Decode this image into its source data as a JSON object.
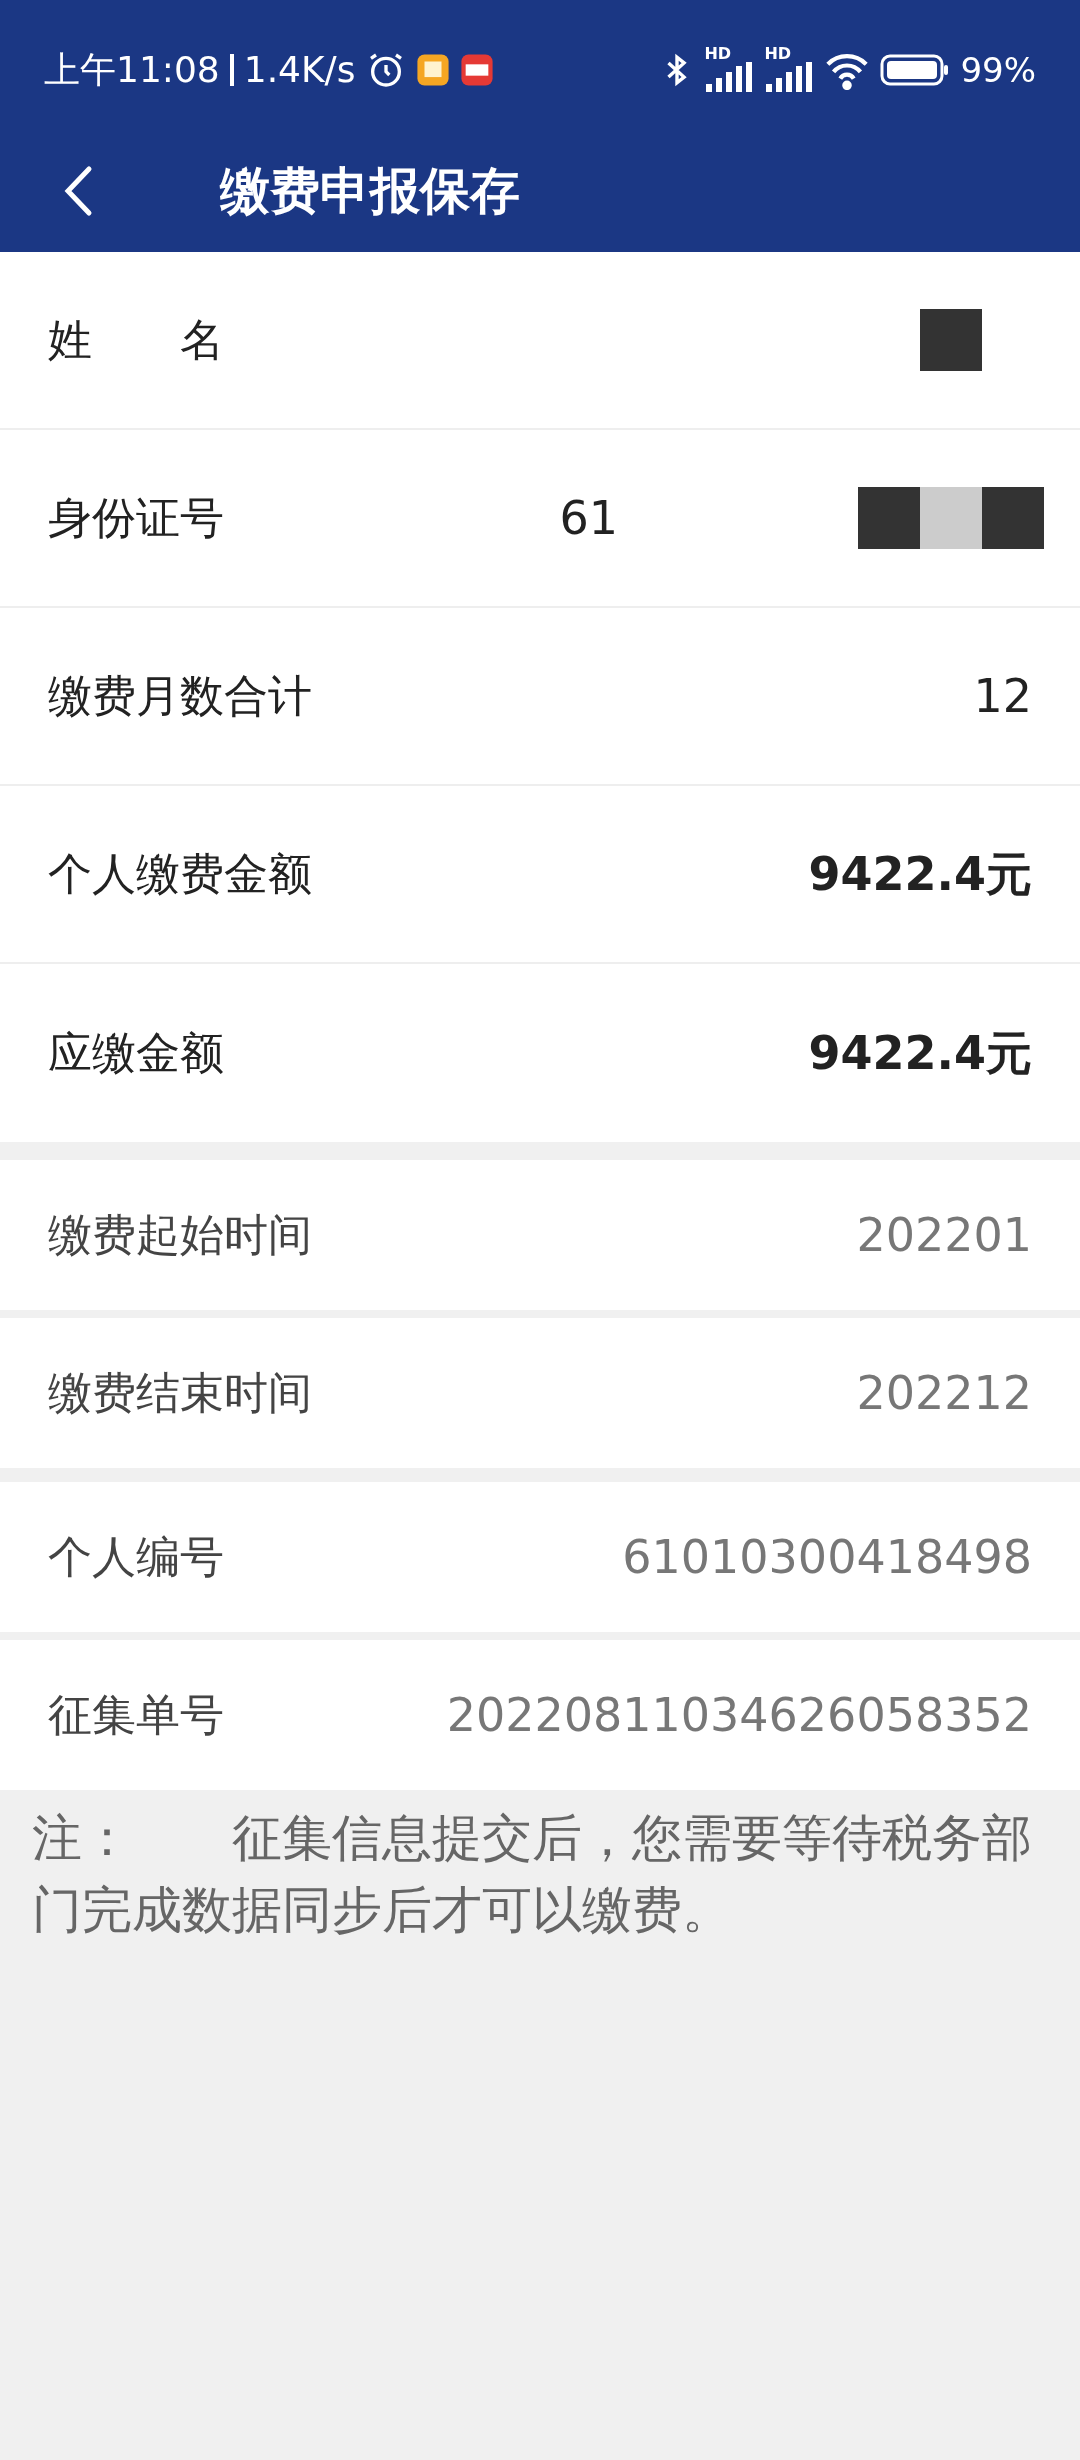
{
  "status_bar": {
    "time": "上午11:08",
    "speed": "1.4K/s",
    "signal_labels": [
      "HD",
      "HD"
    ],
    "battery": "99%"
  },
  "header": {
    "title": "缴费申报保存"
  },
  "sections": [
    {
      "kind": "summary",
      "rows": [
        {
          "label": "姓　　名",
          "redacted": true
        },
        {
          "label": "身份证号",
          "value": "61",
          "redacted": true
        },
        {
          "label": "缴费月数合计",
          "value": "12",
          "bold": false
        },
        {
          "label": "个人缴费金额",
          "value": "9422.4元",
          "bold": true
        },
        {
          "label": "应缴金额",
          "value": "9422.4元",
          "bold": true
        }
      ]
    },
    {
      "kind": "detail",
      "rows": [
        {
          "label": "缴费起始时间",
          "value": "202201"
        },
        {
          "label": "缴费结束时间",
          "value": "202212"
        }
      ]
    },
    {
      "kind": "detail",
      "rows": [
        {
          "label": "个人编号",
          "value": "61010300418498"
        },
        {
          "label": "征集单号",
          "value": "20220811034626058352"
        }
      ]
    }
  ],
  "note": "注：　　征集信息提交后，您需要等待税务部门完成数据同步后才可以缴费。"
}
